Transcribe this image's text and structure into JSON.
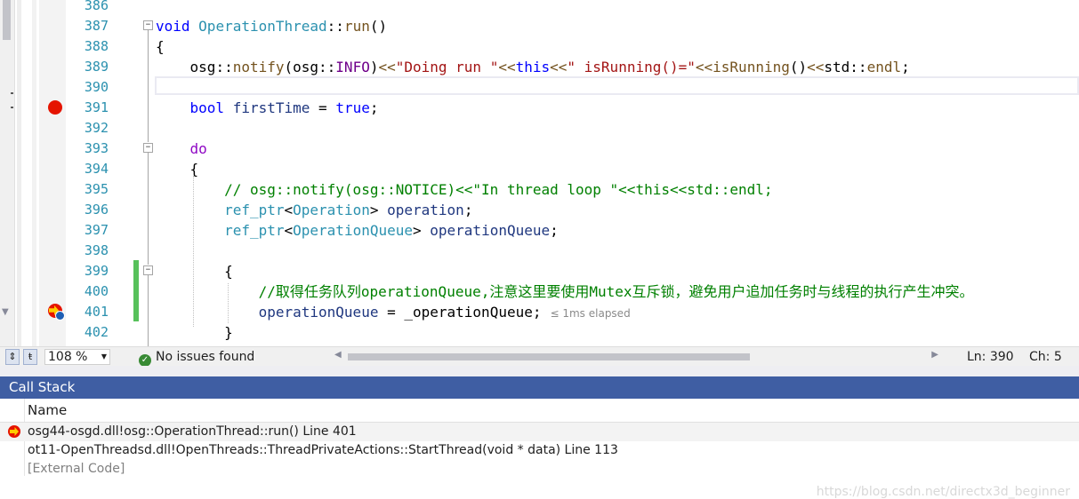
{
  "editor": {
    "lines": [
      {
        "num": "386",
        "tokens": []
      },
      {
        "num": "387",
        "tokens": [
          {
            "c": "kw",
            "t": "void "
          },
          {
            "c": "ty",
            "t": "OperationThread"
          },
          {
            "c": "cn",
            "t": "::"
          },
          {
            "c": "fn",
            "t": "run"
          },
          {
            "c": "cn",
            "t": "()"
          }
        ]
      },
      {
        "num": "388",
        "tokens": [
          {
            "c": "cn",
            "t": "{"
          }
        ]
      },
      {
        "num": "389",
        "tokens": [
          {
            "c": "cn",
            "t": "    osg"
          },
          {
            "c": "cn",
            "t": "::"
          },
          {
            "c": "fn",
            "t": "notify"
          },
          {
            "c": "cn",
            "t": "(osg::"
          },
          {
            "c": "mc",
            "t": "INFO"
          },
          {
            "c": "cn",
            "t": ")"
          },
          {
            "c": "fn",
            "t": "<<"
          },
          {
            "c": "st",
            "t": "\"Doing run \""
          },
          {
            "c": "fn",
            "t": "<<"
          },
          {
            "c": "kw",
            "t": "this"
          },
          {
            "c": "fn",
            "t": "<<"
          },
          {
            "c": "st",
            "t": "\" isRunning()=\""
          },
          {
            "c": "fn",
            "t": "<<"
          },
          {
            "c": "fn",
            "t": "isRunning"
          },
          {
            "c": "cn",
            "t": "()"
          },
          {
            "c": "fn",
            "t": "<<"
          },
          {
            "c": "cn",
            "t": "std::"
          },
          {
            "c": "fn",
            "t": "endl"
          },
          {
            "c": "cn",
            "t": ";"
          }
        ]
      },
      {
        "num": "390",
        "tokens": []
      },
      {
        "num": "391",
        "tokens": [
          {
            "c": "cn",
            "t": "    "
          },
          {
            "c": "kw",
            "t": "bool "
          },
          {
            "c": "pv",
            "t": "firstTime"
          },
          {
            "c": "cn",
            "t": " = "
          },
          {
            "c": "kw",
            "t": "true"
          },
          {
            "c": "cn",
            "t": ";"
          }
        ]
      },
      {
        "num": "392",
        "tokens": []
      },
      {
        "num": "393",
        "tokens": [
          {
            "c": "cn",
            "t": "    "
          },
          {
            "c": "ctl",
            "t": "do"
          }
        ]
      },
      {
        "num": "394",
        "tokens": [
          {
            "c": "cn",
            "t": "    {"
          }
        ]
      },
      {
        "num": "395",
        "tokens": [
          {
            "c": "cn",
            "t": "        "
          },
          {
            "c": "cm",
            "t": "// osg::notify(osg::NOTICE)<<\"In thread loop \"<<this<<std::endl;"
          }
        ]
      },
      {
        "num": "396",
        "tokens": [
          {
            "c": "cn",
            "t": "        "
          },
          {
            "c": "ty",
            "t": "ref_ptr"
          },
          {
            "c": "cn",
            "t": "<"
          },
          {
            "c": "ty",
            "t": "Operation"
          },
          {
            "c": "cn",
            "t": "> "
          },
          {
            "c": "pv",
            "t": "operation"
          },
          {
            "c": "cn",
            "t": ";"
          }
        ]
      },
      {
        "num": "397",
        "tokens": [
          {
            "c": "cn",
            "t": "        "
          },
          {
            "c": "ty",
            "t": "ref_ptr"
          },
          {
            "c": "cn",
            "t": "<"
          },
          {
            "c": "ty",
            "t": "OperationQueue"
          },
          {
            "c": "cn",
            "t": "> "
          },
          {
            "c": "pv",
            "t": "operationQueue"
          },
          {
            "c": "cn",
            "t": ";"
          }
        ]
      },
      {
        "num": "398",
        "tokens": []
      },
      {
        "num": "399",
        "tokens": [
          {
            "c": "cn",
            "t": "        {"
          }
        ]
      },
      {
        "num": "400",
        "tokens": [
          {
            "c": "cn",
            "t": "            "
          },
          {
            "c": "cm",
            "t": "//取得任务队列operationQueue,注意这里要使用Mutex互斥锁，避免用户追加任务时与线程的执行产生冲突。"
          }
        ]
      },
      {
        "num": "401",
        "tokens": [
          {
            "c": "cn",
            "t": "            "
          },
          {
            "c": "pv",
            "t": "operationQueue"
          },
          {
            "c": "cn",
            "t": " = "
          },
          {
            "c": "cn",
            "t": "_operationQueue;"
          }
        ],
        "elapsed": "≤ 1ms elapsed"
      },
      {
        "num": "402",
        "tokens": [
          {
            "c": "cn",
            "t": "        }"
          }
        ]
      }
    ]
  },
  "statusbar": {
    "zoom": "108 %",
    "issues": "No issues found",
    "ln": "Ln: 390",
    "ch": "Ch: 5"
  },
  "callstack": {
    "title": "Call Stack",
    "column": "Name",
    "rows": [
      "osg44-osgd.dll!osg::OperationThread::run() Line 401",
      "ot11-OpenThreadsd.dll!OpenThreads::ThreadPrivateActions::StartThread(void * data) Line 113",
      "[External Code]"
    ]
  },
  "watermark": "https://blog.csdn.net/directx3d_beginner"
}
